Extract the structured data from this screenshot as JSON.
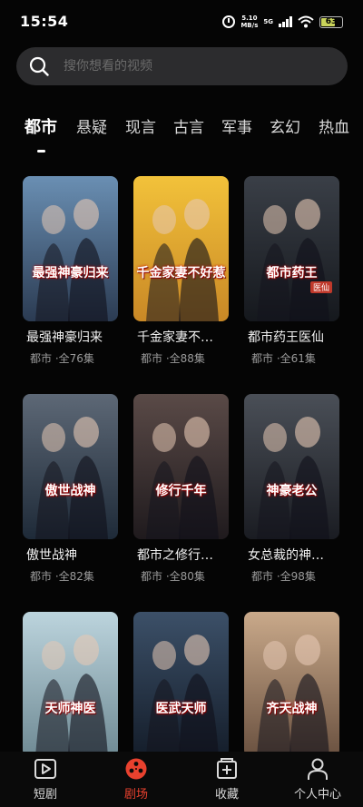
{
  "status_bar": {
    "time": "15:54",
    "net_speed_value": "5.10",
    "net_speed_unit": "MB/s",
    "network": "5G",
    "battery": "63"
  },
  "search": {
    "placeholder": "搜你想看的视频"
  },
  "tabs": [
    {
      "label": "都市",
      "active": true
    },
    {
      "label": "悬疑"
    },
    {
      "label": "现言"
    },
    {
      "label": "古言"
    },
    {
      "label": "军事"
    },
    {
      "label": "玄幻"
    },
    {
      "label": "热血"
    }
  ],
  "dramas": [
    {
      "title": "最强神豪归来",
      "meta": "都市 ·全76集",
      "poster_text": "最强神豪归来",
      "colors": [
        "#6a8fb3",
        "#2b3b52"
      ]
    },
    {
      "title": "千金家妻不…",
      "meta": "都市 ·全88集",
      "poster_text": "千金家妻不好惹",
      "colors": [
        "#f2c23a",
        "#c98826"
      ]
    },
    {
      "title": "都市药王医仙",
      "meta": "都市 ·全61集",
      "poster_text": "都市药王",
      "poster_subtext": "医仙",
      "colors": [
        "#3a3f47",
        "#15181d"
      ]
    },
    {
      "title": "傲世战神",
      "meta": "都市 ·全82集",
      "poster_text": "傲世战神",
      "colors": [
        "#5d6876",
        "#1e2a38"
      ]
    },
    {
      "title": "都市之修行…",
      "meta": "都市 ·全80集",
      "poster_text": "修行千年",
      "colors": [
        "#5a4a47",
        "#1f1a1d"
      ]
    },
    {
      "title": "女总裁的神…",
      "meta": "都市 ·全98集",
      "poster_text": "神豪老公",
      "colors": [
        "#4a4f57",
        "#1a1c22"
      ]
    },
    {
      "title": "",
      "meta": "",
      "poster_text": "天师神医",
      "colors": [
        "#bcd4dd",
        "#6f8a94"
      ]
    },
    {
      "title": "",
      "meta": "",
      "poster_text": "医武天师",
      "colors": [
        "#3c5068",
        "#141d2a"
      ]
    },
    {
      "title": "",
      "meta": "",
      "poster_text": "齐天战神",
      "colors": [
        "#c9a98a",
        "#6a5140"
      ]
    }
  ],
  "bottom_nav": [
    {
      "label": "短剧",
      "icon": "play-square-icon"
    },
    {
      "label": "剧场",
      "icon": "film-reel-icon",
      "active": true
    },
    {
      "label": "收藏",
      "icon": "bookmark-add-icon"
    },
    {
      "label": "个人中心",
      "icon": "person-icon"
    }
  ],
  "colors": {
    "accent": "#e8412e",
    "background": "#050505",
    "search_bg": "#2c2c2e"
  }
}
